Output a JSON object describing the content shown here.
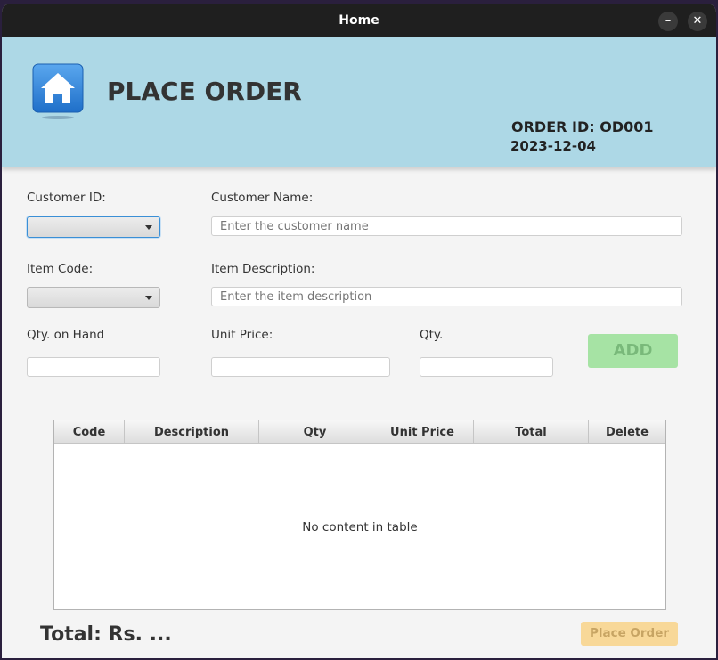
{
  "window": {
    "title": "Home",
    "minimize_icon": "minimize-icon",
    "close_icon": "close-icon"
  },
  "header": {
    "icon": "home-icon",
    "title": "PLACE ORDER",
    "order_id": "ORDER ID: OD001",
    "date": "2023-12-04",
    "background": "#add8e6"
  },
  "form": {
    "customer_id_label": "Customer ID:",
    "customer_id_value": "",
    "customer_name_label": "Customer Name:",
    "customer_name_placeholder": "Enter the customer name",
    "item_code_label": "Item Code:",
    "item_code_value": "",
    "item_description_label": "Item Description:",
    "item_description_placeholder": "Enter the item description",
    "qty_on_hand_label": "Qty. on Hand",
    "unit_price_label": "Unit Price:",
    "qty_label": "Qty.",
    "add_button": "ADD"
  },
  "table": {
    "columns": [
      "Code",
      "Description",
      "Qty",
      "Unit Price",
      "Total",
      "Delete"
    ],
    "rows": [],
    "empty_message": "No content in table"
  },
  "footer": {
    "total": "Total: Rs. ...",
    "place_order_button": "Place Order"
  },
  "colors": {
    "add_button": "#a6e3a4",
    "place_order_button": "#f8d898",
    "focus": "#3a8fd6"
  }
}
